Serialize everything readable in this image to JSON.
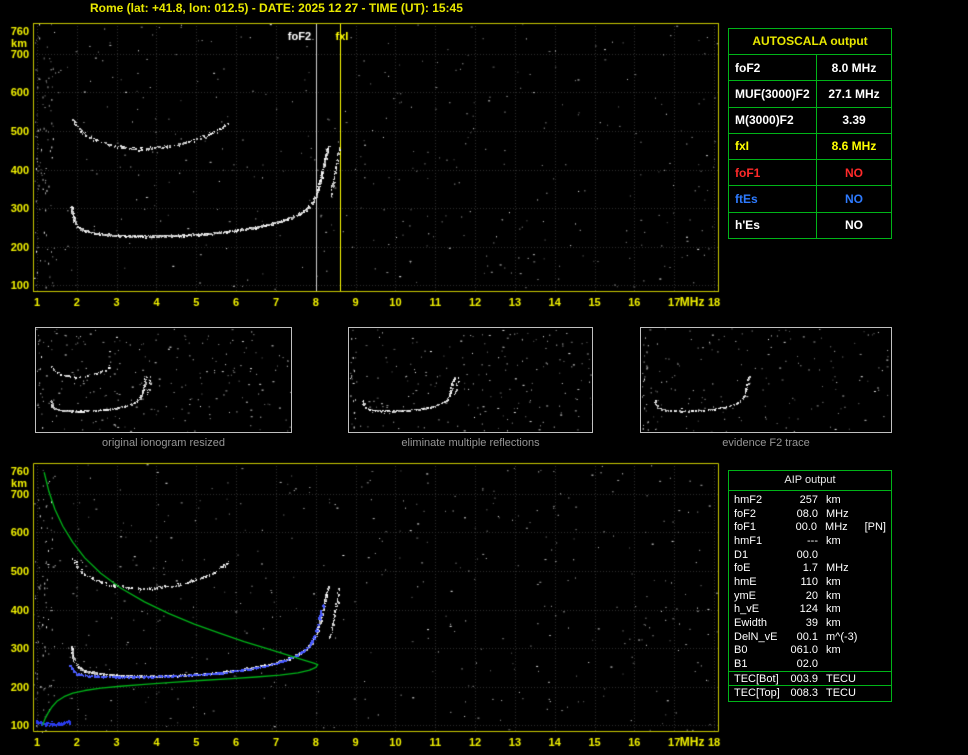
{
  "title": "Rome (lat: +41.8, lon: 012.5) - DATE: 2025 12 27 - TIME (UT): 15:45",
  "colors": {
    "accent_yellow": "#e8e800",
    "accent_green": "#00b418",
    "status_red": "#ff2a2a",
    "status_blue": "#2e7bff",
    "trace_white": "#ffffff",
    "profile_green": "#00b418",
    "restored_blue": "#4a5cff"
  },
  "autoscala_table": {
    "header": "AUTOSCALA output",
    "rows": [
      {
        "label": "foF2",
        "value": "8.0 MHz",
        "color": "#ffffff"
      },
      {
        "label": "MUF(3000)F2",
        "value": "27.1 MHz",
        "color": "#ffffff"
      },
      {
        "label": "M(3000)F2",
        "value": "3.39",
        "color": "#ffffff"
      },
      {
        "label": "fxI",
        "value": "8.6 MHz",
        "color": "#ffff00"
      },
      {
        "label": "foF1",
        "value": "NO",
        "color": "#ff2a2a"
      },
      {
        "label": "ftEs",
        "value": "NO",
        "color": "#2e7bff"
      },
      {
        "label": "h'Es",
        "value": "NO",
        "color": "#ffffff"
      }
    ]
  },
  "aip_table": {
    "header": "AIP output",
    "rows": [
      {
        "label": "hmF2",
        "value": "257",
        "unit": "km",
        "note": "",
        "sep": false
      },
      {
        "label": "foF2",
        "value": "08.0",
        "unit": "MHz",
        "note": "",
        "sep": false
      },
      {
        "label": "foF1",
        "value": "00.0",
        "unit": "MHz",
        "note": "[PN]",
        "sep": false
      },
      {
        "label": "hmF1",
        "value": "---",
        "unit": "km",
        "note": "",
        "sep": false
      },
      {
        "label": "D1",
        "value": "00.0",
        "unit": "",
        "note": "",
        "sep": false
      },
      {
        "label": "foE",
        "value": "1.7",
        "unit": "MHz",
        "note": "",
        "sep": false
      },
      {
        "label": "hmE",
        "value": "110",
        "unit": "km",
        "note": "",
        "sep": false
      },
      {
        "label": "ymE",
        "value": "20",
        "unit": "km",
        "note": "",
        "sep": false
      },
      {
        "label": "h_vE",
        "value": "124",
        "unit": "km",
        "note": "",
        "sep": false
      },
      {
        "label": "Ewidth",
        "value": "39",
        "unit": "km",
        "note": "",
        "sep": false
      },
      {
        "label": "DelN_vE",
        "value": "00.1",
        "unit": "m^(-3)",
        "note": "",
        "sep": false
      },
      {
        "label": "B0",
        "value": "061.0",
        "unit": "km",
        "note": "",
        "sep": false
      },
      {
        "label": "B1",
        "value": "02.0",
        "unit": "",
        "note": "",
        "sep": false
      },
      {
        "label": "TEC[Bot]",
        "value": "003.9",
        "unit": "TECU",
        "note": "",
        "sep": true
      },
      {
        "label": "TEC[Top]",
        "value": "008.3",
        "unit": "TECU",
        "note": "",
        "sep": true
      }
    ]
  },
  "thumbnails": [
    {
      "caption": "original ionogram resized",
      "seed": 3,
      "noise": 220,
      "series_refs": [
        0,
        1,
        2
      ],
      "density_scale": 0.55
    },
    {
      "caption": "eliminate multiple reflections",
      "seed": 4,
      "noise": 195,
      "series_refs": [
        0,
        1
      ],
      "density_scale": 0.55
    },
    {
      "caption": "evidence F2 trace",
      "seed": 5,
      "noise": 165,
      "series_refs": [
        0
      ],
      "density_scale": 0.4
    }
  ],
  "chart_data": [
    {
      "id": "top-ionogram",
      "type": "scatter",
      "title": "ionogram with AUTOSCALA markers",
      "xlabel": "MHz",
      "ylabel": "km",
      "xlim": [
        0.9,
        18.1
      ],
      "ylim": [
        85,
        780
      ],
      "x_ticks": [
        1,
        2,
        3,
        4,
        5,
        6,
        7,
        8,
        9,
        10,
        11,
        12,
        13,
        14,
        15,
        16,
        17,
        18
      ],
      "y_ticks": [
        100,
        200,
        300,
        400,
        500,
        600,
        700,
        760
      ],
      "y_grid": [
        100,
        200,
        300,
        400,
        500,
        600,
        700
      ],
      "grid": true,
      "legend": "none",
      "seed": 7,
      "noise": 400,
      "edge_noise": 90,
      "markers": [
        {
          "x": 8.0,
          "label": "foF2",
          "color": "#d0d0d0",
          "label_color": "#ffffff",
          "label_align": "right"
        },
        {
          "x": 8.6,
          "label": "fxI",
          "color": "#ffff00",
          "label_color": "#ffff00",
          "label_align": "center"
        }
      ],
      "series": [
        {
          "name": "F2 trace (o-mode)",
          "color": "white",
          "jitter": 2.5,
          "density": 2.4,
          "points": [
            [
              1.85,
              308
            ],
            [
              1.9,
              278
            ],
            [
              2.0,
              254
            ],
            [
              2.15,
              244
            ],
            [
              2.4,
              237
            ],
            [
              2.8,
              232
            ],
            [
              3.2,
              229
            ],
            [
              3.7,
              228
            ],
            [
              4.2,
              229
            ],
            [
              4.7,
              231
            ],
            [
              5.2,
              234
            ],
            [
              5.7,
              239
            ],
            [
              6.1,
              245
            ],
            [
              6.5,
              252
            ],
            [
              6.9,
              260
            ],
            [
              7.2,
              270
            ],
            [
              7.5,
              282
            ],
            [
              7.75,
              297
            ],
            [
              7.9,
              315
            ],
            [
              8.02,
              340
            ],
            [
              8.1,
              370
            ],
            [
              8.17,
              400
            ],
            [
              8.22,
              425
            ],
            [
              8.28,
              450
            ],
            [
              8.32,
              462
            ]
          ]
        },
        {
          "name": "F2 trace (x-mode)",
          "color": "white",
          "jitter": 3,
          "density": 1.0,
          "points": [
            [
              8.36,
              330
            ],
            [
              8.42,
              362
            ],
            [
              8.47,
              392
            ],
            [
              8.52,
              420
            ],
            [
              8.56,
              444
            ],
            [
              8.59,
              458
            ]
          ]
        },
        {
          "name": "second reflection",
          "color": "white",
          "jitter": 5,
          "density": 1.0,
          "points": [
            [
              1.9,
              532
            ],
            [
              2.0,
              512
            ],
            [
              2.15,
              496
            ],
            [
              2.35,
              483
            ],
            [
              2.6,
              472
            ],
            [
              2.95,
              463
            ],
            [
              3.3,
              457
            ],
            [
              3.7,
              455
            ],
            [
              4.1,
              459
            ],
            [
              4.5,
              466
            ],
            [
              4.9,
              476
            ],
            [
              5.2,
              487
            ],
            [
              5.45,
              499
            ],
            [
              5.65,
              512
            ],
            [
              5.8,
              524
            ]
          ]
        }
      ]
    },
    {
      "id": "bottom-ionogram",
      "type": "scatter",
      "title": "ionogram with restored trace and electron density profile",
      "xlabel": "MHz",
      "ylabel": "km",
      "xlim": [
        0.9,
        18.1
      ],
      "ylim": [
        85,
        780
      ],
      "x_ticks": [
        1,
        2,
        3,
        4,
        5,
        6,
        7,
        8,
        9,
        10,
        11,
        12,
        13,
        14,
        15,
        16,
        17,
        18
      ],
      "y_ticks": [
        100,
        200,
        300,
        400,
        500,
        600,
        700,
        760
      ],
      "y_grid": [
        100,
        200,
        300,
        400,
        500,
        600,
        700
      ],
      "grid": true,
      "legend": "none",
      "seed": 13,
      "noise": 430,
      "edge_noise": 70,
      "markers": [],
      "series": [
        {
          "name": "F2 trace (o-mode)",
          "color": "white",
          "jitter": 2.5,
          "density": 2.2,
          "points": [
            [
              1.85,
              308
            ],
            [
              1.9,
              278
            ],
            [
              2.0,
              254
            ],
            [
              2.15,
              244
            ],
            [
              2.4,
              237
            ],
            [
              2.8,
              232
            ],
            [
              3.2,
              229
            ],
            [
              3.7,
              228
            ],
            [
              4.2,
              229
            ],
            [
              4.7,
              231
            ],
            [
              5.2,
              234
            ],
            [
              5.7,
              239
            ],
            [
              6.1,
              245
            ],
            [
              6.5,
              252
            ],
            [
              6.9,
              260
            ],
            [
              7.2,
              270
            ],
            [
              7.5,
              282
            ],
            [
              7.75,
              297
            ],
            [
              7.9,
              315
            ],
            [
              8.02,
              340
            ],
            [
              8.1,
              370
            ],
            [
              8.17,
              400
            ],
            [
              8.22,
              425
            ],
            [
              8.28,
              450
            ],
            [
              8.32,
              462
            ]
          ]
        },
        {
          "name": "F2 trace (x-mode)",
          "color": "white",
          "jitter": 3,
          "density": 0.9,
          "points": [
            [
              8.36,
              330
            ],
            [
              8.42,
              362
            ],
            [
              8.47,
              392
            ],
            [
              8.52,
              420
            ],
            [
              8.56,
              444
            ],
            [
              8.59,
              458
            ]
          ]
        },
        {
          "name": "second reflection",
          "color": "white",
          "jitter": 5,
          "density": 0.9,
          "points": [
            [
              1.9,
              532
            ],
            [
              2.0,
              512
            ],
            [
              2.15,
              496
            ],
            [
              2.35,
              483
            ],
            [
              2.6,
              472
            ],
            [
              2.95,
              463
            ],
            [
              3.3,
              457
            ],
            [
              3.7,
              455
            ],
            [
              4.1,
              459
            ],
            [
              4.5,
              466
            ],
            [
              4.9,
              476
            ],
            [
              5.2,
              487
            ],
            [
              5.45,
              499
            ],
            [
              5.65,
              512
            ],
            [
              5.8,
              524
            ]
          ]
        },
        {
          "name": "restored F2 trace",
          "color": "#4a5cff",
          "jitter": 1.8,
          "density": 1.6,
          "points": [
            [
              1.82,
              258
            ],
            [
              1.9,
              240
            ],
            [
              2.05,
              233
            ],
            [
              2.3,
              229
            ],
            [
              2.7,
              227
            ],
            [
              3.2,
              226
            ],
            [
              3.8,
              227
            ],
            [
              4.4,
              229
            ],
            [
              5.0,
              232
            ],
            [
              5.5,
              236
            ],
            [
              6.0,
              242
            ],
            [
              6.5,
              250
            ],
            [
              6.9,
              259
            ],
            [
              7.25,
              270
            ],
            [
              7.55,
              284
            ],
            [
              7.8,
              303
            ],
            [
              7.95,
              330
            ],
            [
              8.05,
              362
            ],
            [
              8.12,
              392
            ],
            [
              8.17,
              415
            ]
          ]
        },
        {
          "name": "restored trace start",
          "color": "#2a3cf0",
          "jitter": 6,
          "density": 3.5,
          "points": [
            [
              0.98,
              110
            ],
            [
              1.2,
              106
            ],
            [
              1.45,
              104
            ],
            [
              1.65,
              107
            ],
            [
              1.8,
              111
            ]
          ]
        },
        {
          "name": "electron density profile",
          "color": "#00b418",
          "line": true,
          "points": [
            [
              1.18,
              756
            ],
            [
              1.3,
              706
            ],
            [
              1.45,
              660
            ],
            [
              1.65,
              616
            ],
            [
              1.9,
              574
            ],
            [
              2.2,
              534
            ],
            [
              2.6,
              494
            ],
            [
              3.1,
              456
            ],
            [
              3.7,
              420
            ],
            [
              4.3,
              390
            ],
            [
              4.95,
              362
            ],
            [
              5.6,
              338
            ],
            [
              6.2,
              317
            ],
            [
              6.8,
              298
            ],
            [
              7.3,
              282
            ],
            [
              7.7,
              269
            ],
            [
              7.95,
              261
            ],
            [
              8.05,
              257
            ],
            [
              8.0,
              250
            ],
            [
              7.85,
              243
            ],
            [
              7.55,
              236
            ],
            [
              7.1,
              230
            ],
            [
              6.5,
              225
            ],
            [
              5.8,
              220
            ],
            [
              5.1,
              216
            ],
            [
              4.4,
              211
            ],
            [
              3.7,
              206
            ],
            [
              3.1,
              201
            ],
            [
              2.6,
              196
            ],
            [
              2.2,
              190
            ],
            [
              1.9,
              183
            ],
            [
              1.68,
              174
            ],
            [
              1.5,
              162
            ],
            [
              1.38,
              148
            ],
            [
              1.28,
              132
            ],
            [
              1.2,
              116
            ],
            [
              1.14,
              100
            ]
          ]
        }
      ]
    }
  ]
}
